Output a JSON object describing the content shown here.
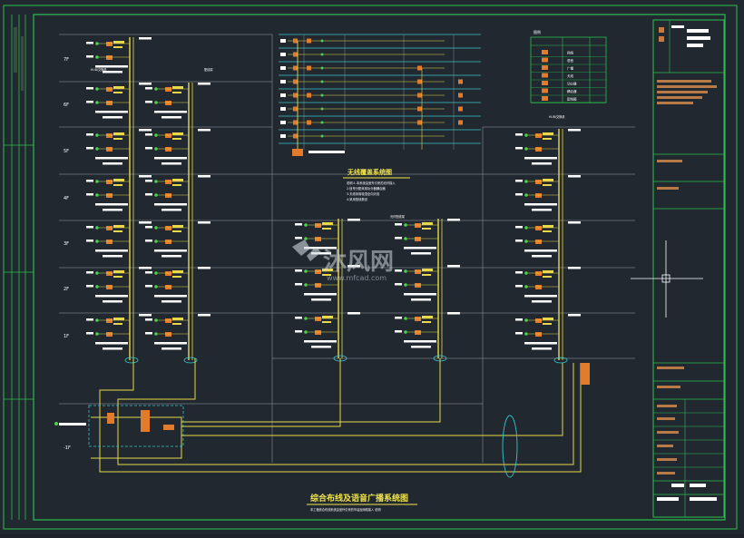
{
  "drawing": {
    "main_title": "综合布线及语音广播系统图",
    "main_note": "本工程综合布线系统由室外引来的市话及网络接入 说明",
    "sub_title": "无线覆盖系统图",
    "sub_notes": [
      "说明:1.本系统由室外引来的光纤接入",
      "2.信号分配采用功分器耦合器",
      "3.天线采用吸顶全向天线",
      "4.采用馈线敷设"
    ],
    "floors_left": [
      "7F",
      "6F",
      "5F",
      "4F",
      "3F",
      "2F",
      "1F",
      "-1F"
    ],
    "node_labels": [
      "HUB/交换机",
      "配线架",
      "光纤配线架"
    ],
    "watermark": "沐风网",
    "watermark_url": "www.mfcad.com"
  },
  "legend": {
    "title": "图例",
    "rows": [
      {
        "symbol": "▣",
        "text": "网络"
      },
      {
        "symbol": "▣",
        "text": "语音"
      },
      {
        "symbol": "▣",
        "text": "广播"
      },
      {
        "symbol": "▣",
        "text": "天线"
      },
      {
        "symbol": "▣",
        "text": "功分器"
      },
      {
        "symbol": "▣",
        "text": "耦合器"
      },
      {
        "symbol": "▣",
        "text": "配线箱"
      }
    ]
  },
  "title_block": {
    "labels": [
      "设计单位",
      "工程名称",
      "图名",
      "比例",
      "日期",
      "图号"
    ]
  },
  "colors": {
    "background": "#212830",
    "frame": "#1fbf4a",
    "cable": "#e8d84a",
    "grid": "#9aa0a6",
    "cyan": "#37c6c9",
    "device": "#e27b2b"
  }
}
